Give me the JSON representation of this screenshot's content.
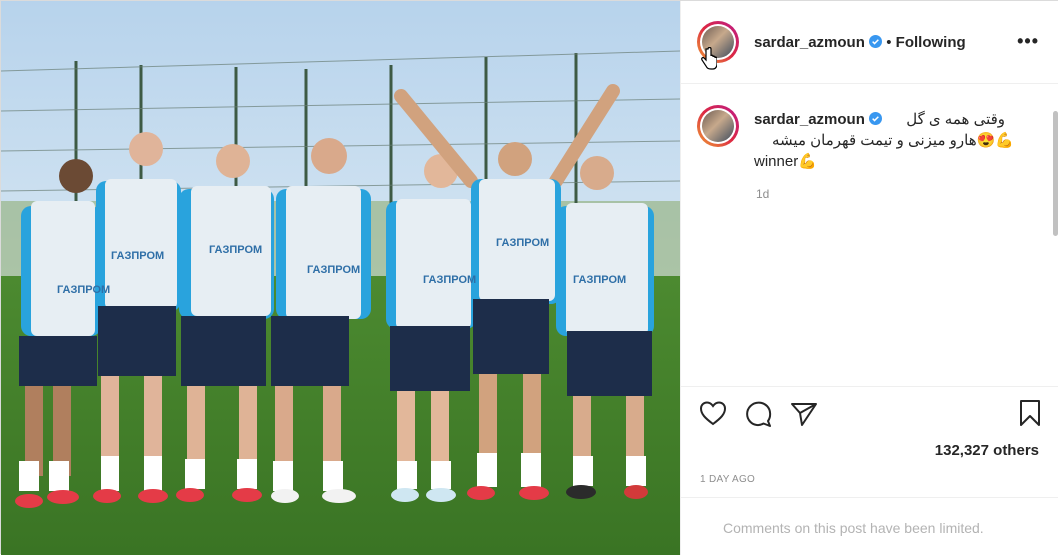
{
  "post": {
    "username": "sardar_azmoun",
    "separator": "•",
    "follow_state": "Following",
    "more_label": "•••",
    "caption_line1": "وقتی همه ی گل",
    "caption_line2": "💪😍هارو میزنی و تیمت قهرمان میشه",
    "caption_line3": "winner💪",
    "caption_time": "1d",
    "likes_text": "132,327 others",
    "posted_ago": "1 DAY AGO",
    "comments_notice": "Comments on this post have been limited."
  },
  "photo": {
    "sky_color": "#9dc4e6",
    "grass_color": "#3f7d2a",
    "shirt_color": "#29a3dd",
    "bib_color": "#e7eef3",
    "bib_text": "ГАЗПРОМ"
  },
  "icons": {
    "like": "heart-icon",
    "comment": "comment-icon",
    "share": "paper-plane-icon",
    "save": "bookmark-icon",
    "verified": "verified-badge-icon",
    "cursor": "hand-cursor-icon"
  }
}
